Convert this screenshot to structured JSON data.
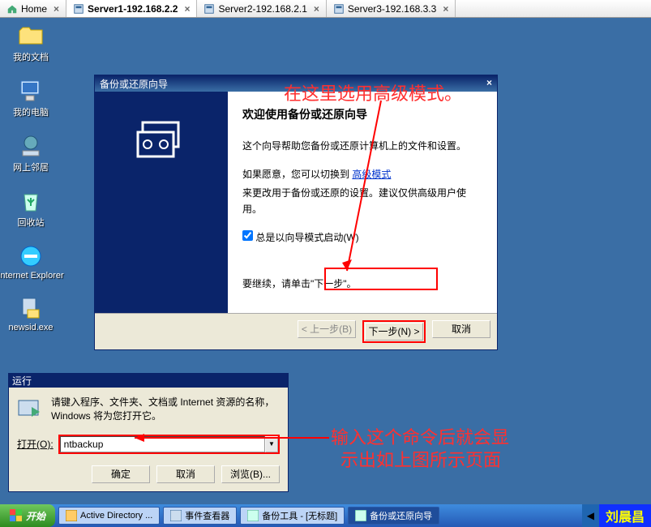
{
  "tabs": [
    {
      "label": "Home",
      "icon": "home"
    },
    {
      "label": "Server1-192.168.2.2",
      "icon": "server",
      "active": true
    },
    {
      "label": "Server2-192.168.2.1",
      "icon": "server"
    },
    {
      "label": "Server3-192.168.3.3",
      "icon": "server"
    }
  ],
  "desktop_icons": [
    {
      "name": "my-documents",
      "label": "我的文档"
    },
    {
      "name": "my-computer",
      "label": "我的电脑"
    },
    {
      "name": "network-places",
      "label": "网上邻居"
    },
    {
      "name": "recycle-bin",
      "label": "回收站"
    },
    {
      "name": "internet-explorer",
      "label": "Internet Explorer"
    },
    {
      "name": "newsid-exe",
      "label": "newsid.exe"
    }
  ],
  "run_dialog": {
    "title": "运行",
    "description": "请键入程序、文件夹、文档或 Internet 资源的名称，Windows 将为您打开它。",
    "open_label": "打开(O):",
    "open_value": "ntbackup",
    "buttons": {
      "ok": "确定",
      "cancel": "取消",
      "browse": "浏览(B)..."
    }
  },
  "wizard": {
    "title": "备份或还原向导",
    "heading": "欢迎使用备份或还原向导",
    "intro": "这个向导帮助您备份或还原计算机上的文件和设置。",
    "advanced_prefix": "如果愿意，您可以切换到",
    "advanced_link": "高级模式",
    "advanced_suffix_line": "来更改用于备份或还原的设置。建议仅供高级用户使用。",
    "checkbox_label": "总是以向导模式启动(W)",
    "continue_text": "要继续，请单击\"下一步\"。",
    "buttons": {
      "back": "< 上一步(B)",
      "next": "下一步(N) >",
      "cancel": "取消"
    }
  },
  "annotations": {
    "top1": "在这里选用高级模式。",
    "bottom1": "输入这个命令后就会显",
    "bottom2": "示出如上图所示页面"
  },
  "taskbar": {
    "start": "开始",
    "items": [
      {
        "label": "Active Directory ..."
      },
      {
        "label": "事件查看器"
      },
      {
        "label": "备份工具 - [无标题]"
      },
      {
        "label": "备份或还原向导",
        "pressed": true
      }
    ],
    "watermark": "刘晨昌"
  }
}
